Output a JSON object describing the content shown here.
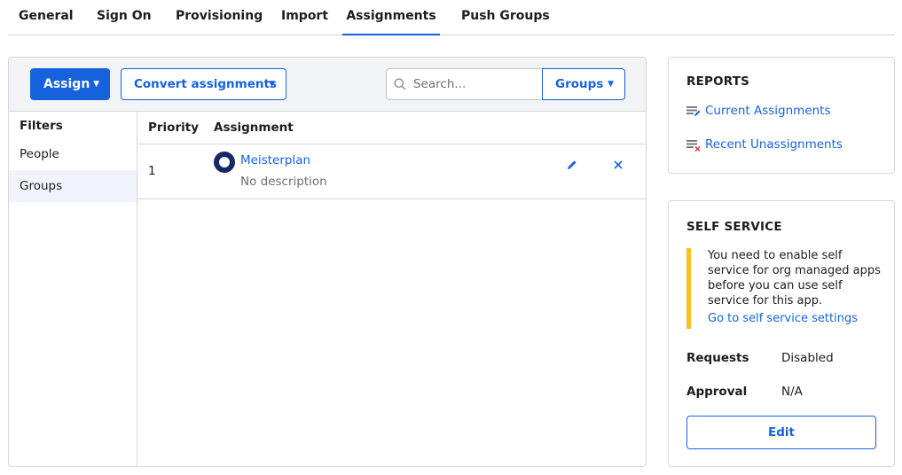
{
  "tabs": [
    {
      "label": "General"
    },
    {
      "label": "Sign On"
    },
    {
      "label": "Provisioning"
    },
    {
      "label": "Import"
    },
    {
      "label": "Assignments"
    },
    {
      "label": "Push Groups"
    }
  ],
  "active_tab": "Assignments",
  "toolbar": {
    "assign_label": "Assign",
    "convert_label": "Convert assignments",
    "search_placeholder": "Search...",
    "search_value": "",
    "groups_label": "Groups"
  },
  "filters": {
    "title": "Filters",
    "items": [
      {
        "label": "People"
      },
      {
        "label": "Groups"
      }
    ],
    "selected": "Groups"
  },
  "table": {
    "columns": [
      "Priority",
      "Assignment"
    ],
    "rows": [
      {
        "priority": "1",
        "name": "Meisterplan",
        "description": "No description"
      }
    ]
  },
  "reports": {
    "title": "REPORTS",
    "links": [
      {
        "label": "Current Assignments",
        "icon": "report-list-icon"
      },
      {
        "label": "Recent Unassignments",
        "icon": "report-remove-icon"
      }
    ]
  },
  "self_service": {
    "title": "SELF SERVICE",
    "notice": "You need to enable self service for org managed apps before you can use self service for this app.",
    "notice_link": "Go to self service settings",
    "requests_label": "Requests",
    "requests_value": "Disabled",
    "approval_label": "Approval",
    "approval_value": "N/A",
    "edit_label": "Edit"
  },
  "colors": {
    "accent": "#1662dd",
    "warning": "#f7c21f",
    "group_icon": "#16276a",
    "danger": "#d93934"
  }
}
